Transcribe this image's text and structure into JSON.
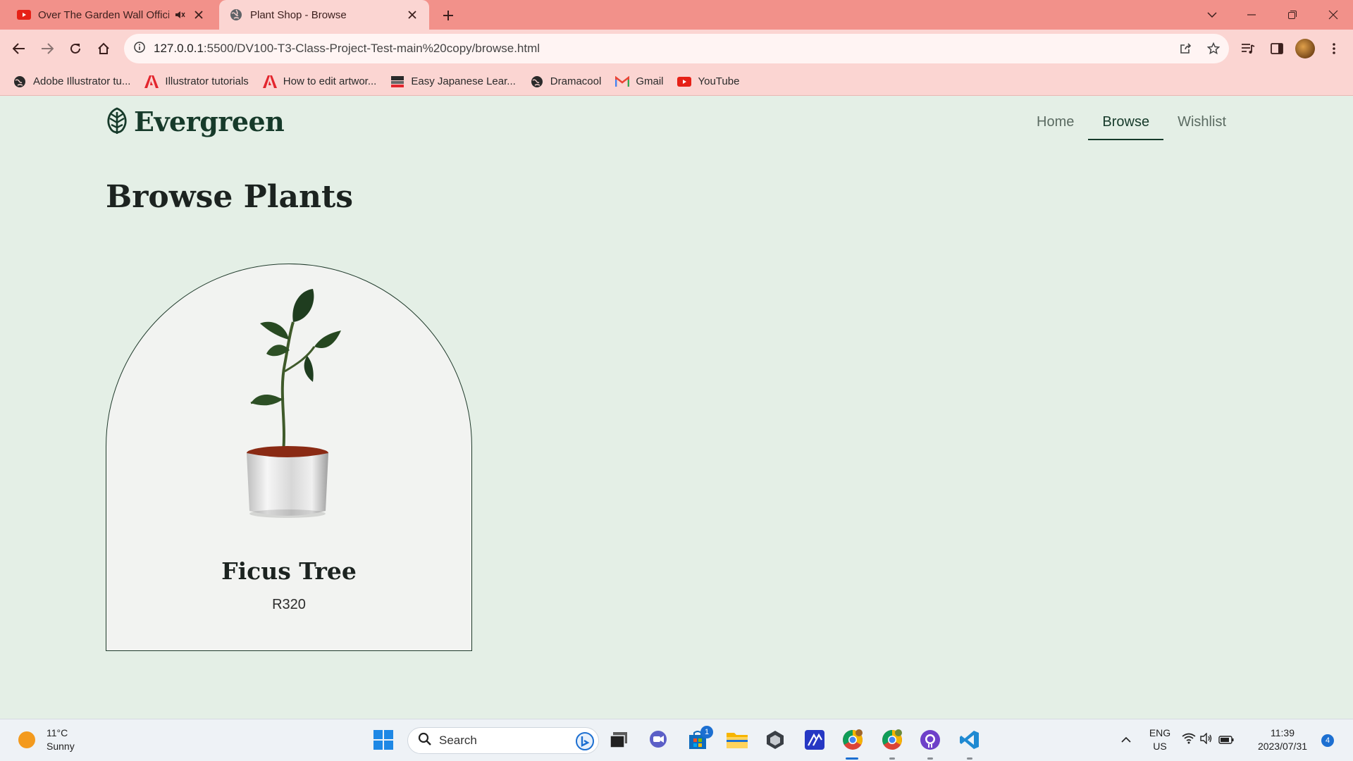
{
  "browser": {
    "tabs": [
      {
        "title": "Over The Garden Wall Officia",
        "favicon": "youtube-icon",
        "audio": "speaker-mute-icon"
      },
      {
        "title": "Plant Shop - Browse",
        "favicon": "globe-icon"
      }
    ],
    "url_host": "127.0.0.1",
    "url_rest": ":5500/DV100-T3-Class-Project-Test-main%20copy/browse.html",
    "bookmarks": [
      {
        "label": "Adobe Illustrator tu...",
        "icon": "globe-icon"
      },
      {
        "label": "Illustrator tutorials",
        "icon": "adobe-icon"
      },
      {
        "label": "How to edit artwor...",
        "icon": "adobe-icon"
      },
      {
        "label": "Easy Japanese Lear...",
        "icon": "nhk-icon"
      },
      {
        "label": "Dramacool",
        "icon": "globe-icon"
      },
      {
        "label": "Gmail",
        "icon": "gmail-icon"
      },
      {
        "label": "YouTube",
        "icon": "youtube-icon"
      }
    ]
  },
  "site": {
    "brand": "Evergreen",
    "nav": [
      "Home",
      "Browse",
      "Wishlist"
    ],
    "active_nav": "Browse",
    "page_title": "Browse Plants",
    "products": [
      {
        "name": "Ficus Tree",
        "price": "R320"
      }
    ]
  },
  "taskbar": {
    "weather_temp": "11°C",
    "weather_desc": "Sunny",
    "search_placeholder": "Search",
    "store_badge": "1",
    "lang": "ENG",
    "region": "US",
    "time": "11:39",
    "date": "2023/07/31",
    "notif_count": "4"
  },
  "colors": {
    "tab_strip": "#f2918a",
    "toolbar": "#fbd5d2",
    "page_bg": "#e4efe6",
    "brand_green": "#163a2a"
  }
}
